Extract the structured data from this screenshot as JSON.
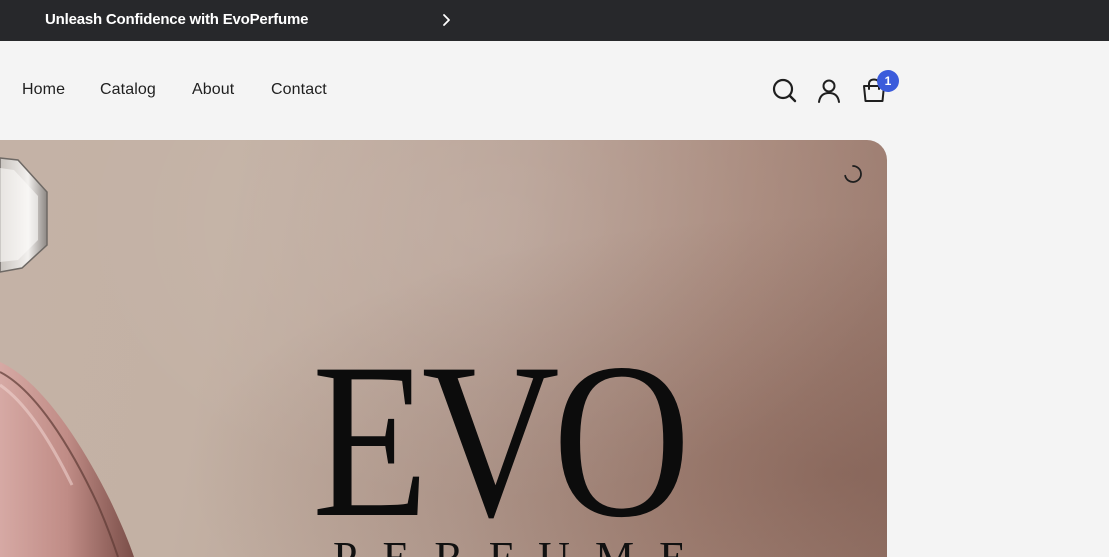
{
  "announcement": {
    "text": "Unleash Confidence with EvoPerfume",
    "arrow_icon": "chevron-right-icon"
  },
  "nav": {
    "links": [
      {
        "label": "Home"
      },
      {
        "label": "Catalog"
      },
      {
        "label": "About"
      },
      {
        "label": "Contact"
      }
    ]
  },
  "header_icons": {
    "search": "search-icon",
    "account": "user-icon",
    "cart": "cart-icon",
    "cart_count": "1"
  },
  "hero": {
    "brand_main": "EVO",
    "brand_sub": "PERFUME",
    "loading_icon": "spinner-icon"
  },
  "colors": {
    "announcement_bg": "#27282b",
    "page_bg": "#f4f4f4",
    "badge": "#3b5bdb"
  }
}
